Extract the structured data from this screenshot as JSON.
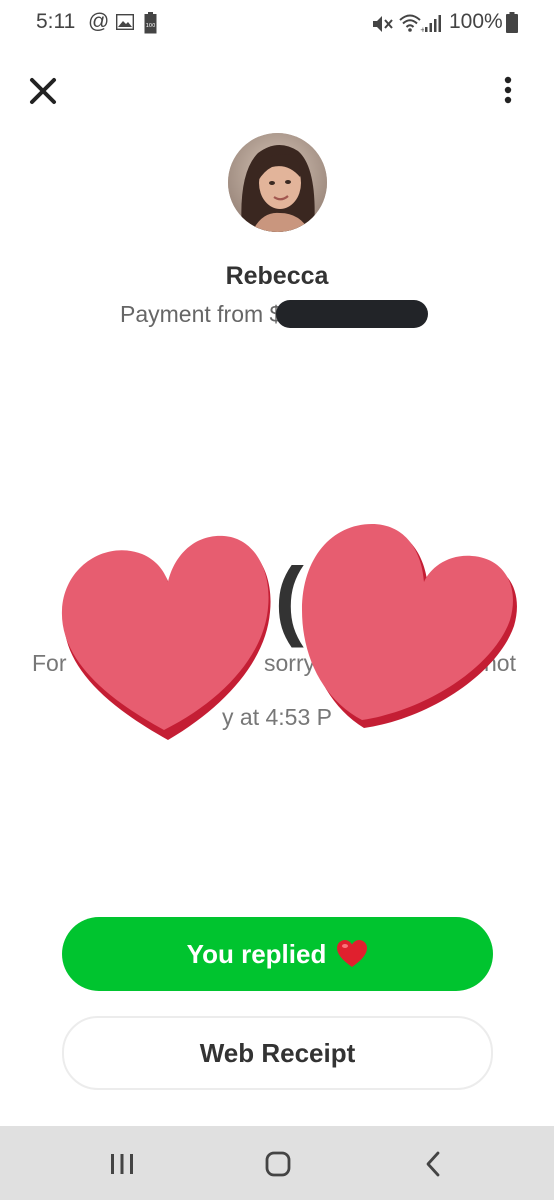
{
  "status_bar": {
    "time": "5:11",
    "at_symbol": "@",
    "battery_percent": "100%",
    "icons": [
      "gallery-icon",
      "battery-saver-icon",
      "mute-icon",
      "wifi-icon",
      "signal-icon",
      "battery-icon"
    ]
  },
  "header": {
    "close_icon": "close-icon",
    "more_icon": "more-vertical-icon"
  },
  "profile": {
    "name": "Rebecca",
    "payment_prefix": "Payment from $"
  },
  "payment": {
    "amount_visible": ".(",
    "note_visible_left": "For",
    "note_visible_middle": "sorry",
    "note_visible_right": "not",
    "date_visible": "y at 4:53 P"
  },
  "actions": {
    "replied_label": "You replied",
    "receipt_label": "Web Receipt"
  },
  "colors": {
    "accent_green": "#00c42f",
    "heart_pink": "#e75d70",
    "heart_shadow": "#c41e34",
    "redaction": "#222428",
    "nav_bar": "#e0e0e0"
  },
  "nav": {
    "recents_icon": "recents-icon",
    "home_icon": "home-icon",
    "back_icon": "back-icon"
  }
}
